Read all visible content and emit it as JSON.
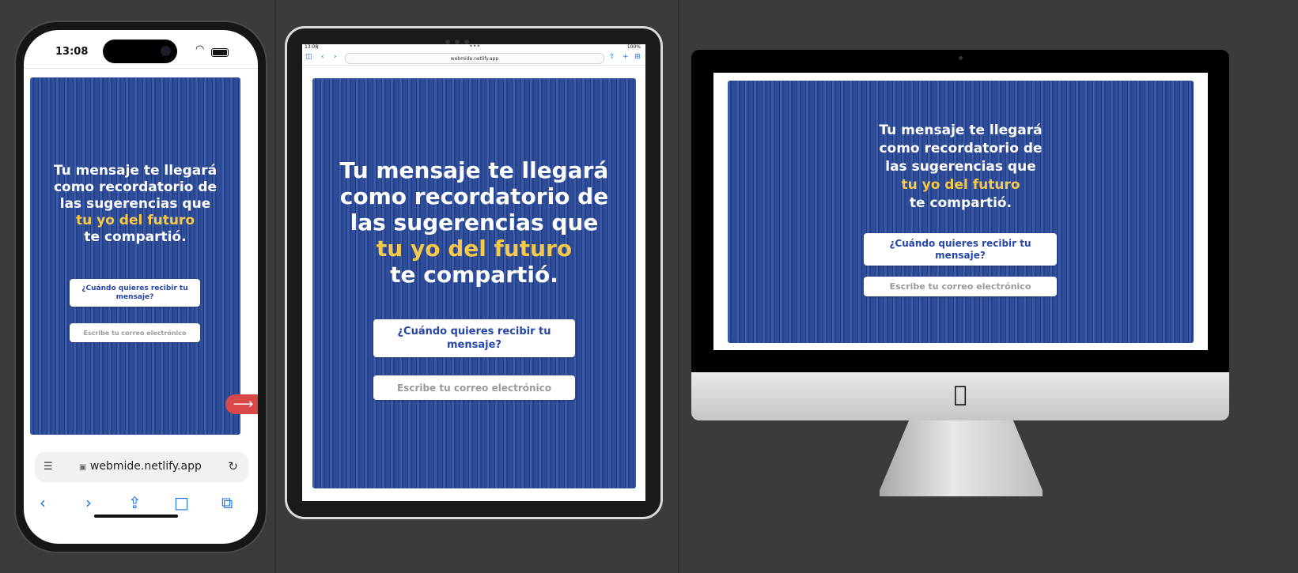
{
  "phone": {
    "status_time": "13:08",
    "address_url": "webmide.netlify.app",
    "next_arrow": "⟶"
  },
  "tablet": {
    "status_time": "13:08",
    "status_right": "100%",
    "address_url": "webmide.netlify.app"
  },
  "page": {
    "headline_line1": "Tu mensaje te llegará",
    "headline_line2": "como recordatorio de",
    "headline_line3": "las sugerencias que",
    "headline_highlight": "tu yo del futuro",
    "headline_line5": "te compartió.",
    "when_button": "¿Cuándo quieres recibir tu mensaje?",
    "email_placeholder": "Escribe tu correo electrónico"
  },
  "icons": {
    "tabs": "tabs-icon",
    "lock": "lock-icon",
    "reload": "reload-icon",
    "back": "chevron-left-icon",
    "forward": "chevron-right-icon",
    "share": "share-icon",
    "bookmarks": "book-icon",
    "tab_overview": "tabs-overview-icon",
    "apple": "apple-logo-icon"
  },
  "colors": {
    "background": "#3b3b3b",
    "page_blue": "#2a4690",
    "highlight_yellow": "#f7c948",
    "button_text_blue": "#2646a8",
    "arrow_red": "#d94848"
  }
}
